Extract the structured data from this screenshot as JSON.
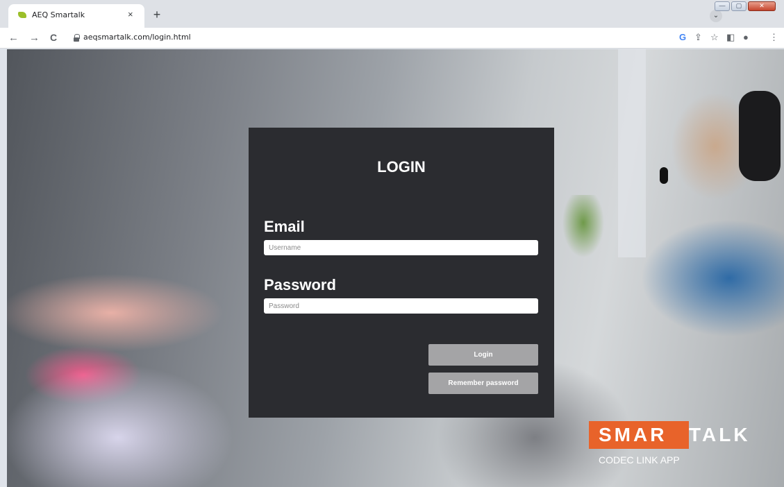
{
  "browser": {
    "tab_title": "AEQ Smartalk",
    "tab_close": "×",
    "new_tab": "+",
    "tab_search": "⌄",
    "url": "aeqsmartalk.com/login.html",
    "nav": {
      "back": "←",
      "forward": "→",
      "reload": "C"
    },
    "toolbar_icons": [
      "google-icon",
      "share-icon",
      "star-icon",
      "sidepanel-icon",
      "profile-icon",
      "menu-icon"
    ],
    "toolbar_glyphs": {
      "google": "G",
      "share": "⇪",
      "star": "☆",
      "sidepanel": "◧",
      "profile": "●",
      "menu": "⋮"
    },
    "window": {
      "minimize": "—",
      "maximize": "▢",
      "close": "✕"
    }
  },
  "login": {
    "title": "LOGIN",
    "email_label": "Email",
    "email_placeholder": "Username",
    "password_label": "Password",
    "password_placeholder": "Password",
    "login_button": "Login",
    "remember_button": "Remember password"
  },
  "logo": {
    "part1": "SMAR",
    "part2": "TALK",
    "subtitle": "CODEC LINK APP",
    "accent_color": "#e8632a"
  },
  "colors": {
    "card_bg": "#2b2c30",
    "button_bg": "#a4a4a6"
  }
}
